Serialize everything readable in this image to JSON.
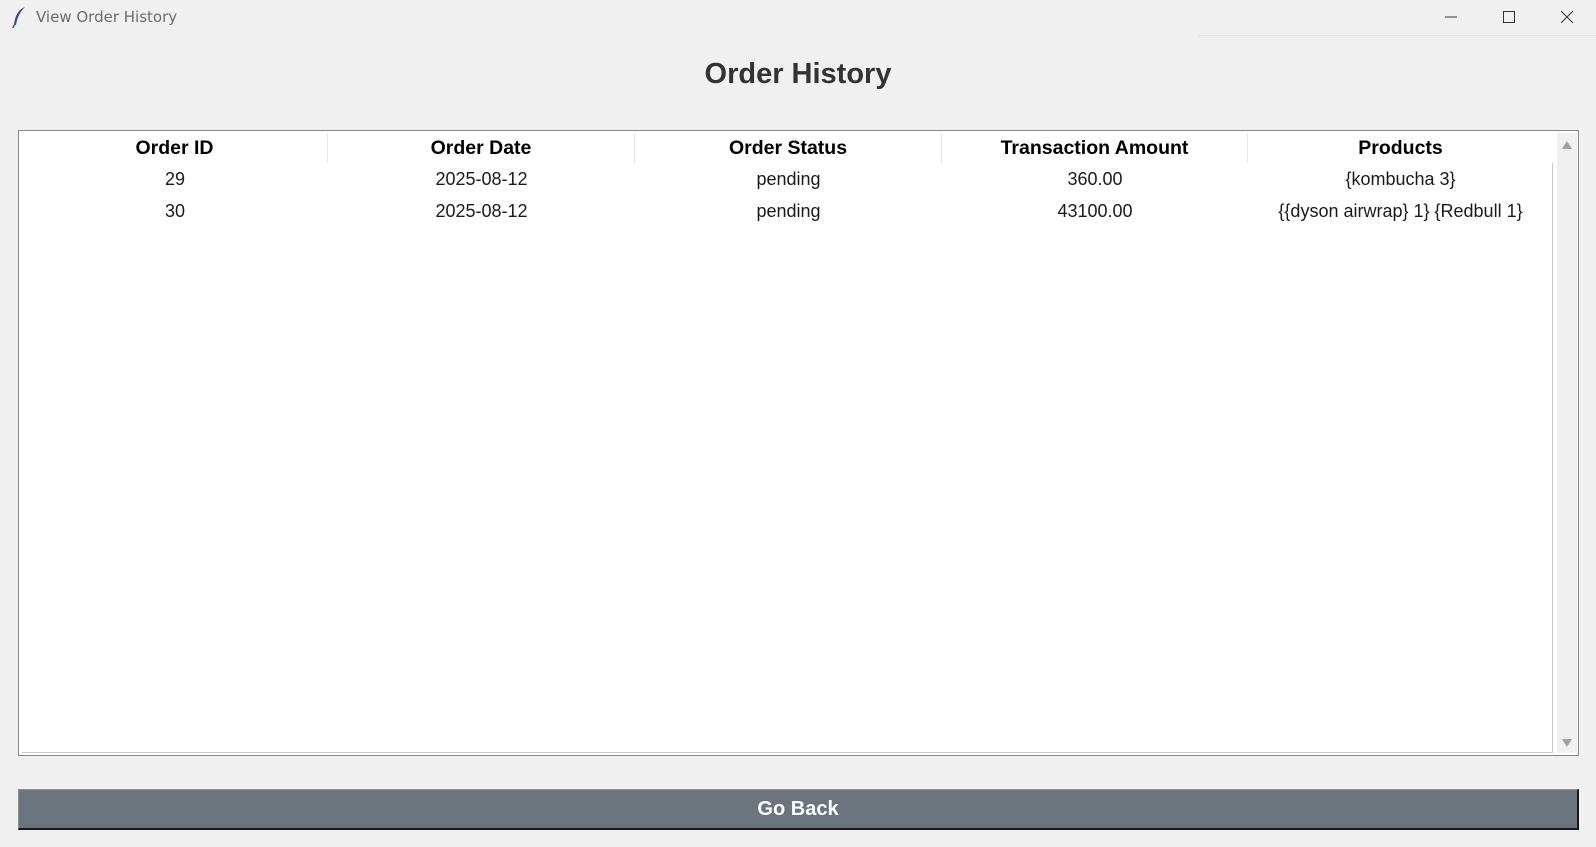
{
  "window": {
    "title": "View Order History",
    "icon": "feather-icon"
  },
  "heading": "Order History",
  "table": {
    "columns": [
      "Order ID",
      "Order Date",
      "Order Status",
      "Transaction Amount",
      "Products"
    ],
    "rows": [
      [
        "29",
        "2025-08-12",
        "pending",
        "360.00",
        "{kombucha 3}"
      ],
      [
        "30",
        "2025-08-12",
        "pending",
        "43100.00",
        "{{dyson airwrap} 1} {Redbull 1}"
      ]
    ]
  },
  "go_back_label": "Go Back",
  "colors": {
    "button_bg": "#6c757d",
    "button_text": "#ffffff",
    "heading": "#333333",
    "window_bg": "#f0f0f0"
  }
}
